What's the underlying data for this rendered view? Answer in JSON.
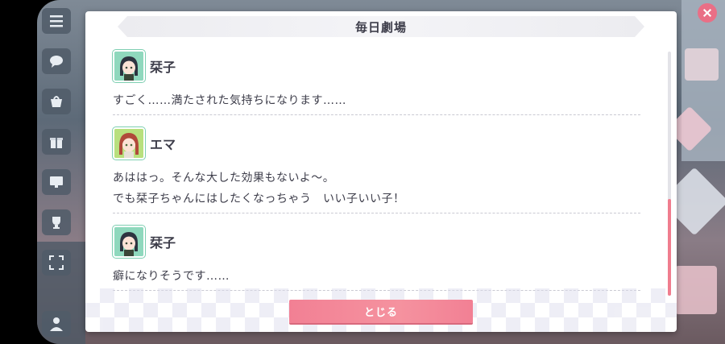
{
  "dialog": {
    "title": "毎日劇場",
    "close_label": "とじる"
  },
  "entries": [
    {
      "speaker": "栞子",
      "lines": [
        "すごく……満たされた気持ちになります……"
      ]
    },
    {
      "speaker": "エマ",
      "lines": [
        "あははっ。そんな大した効果もないよ〜。",
        "でも栞子ちゃんにはしたくなっちゃう　いい子いい子！"
      ]
    },
    {
      "speaker": "栞子",
      "lines": [
        "癖になりそうです……"
      ]
    }
  ],
  "colors": {
    "accent": "#f28094",
    "scroll_thumb": "#f07d8e",
    "text": "#3d3d4a"
  },
  "icons": [
    "menu-icon",
    "chat-icon",
    "shop-icon",
    "gift-icon",
    "screen-icon",
    "trophy-icon",
    "fullscreen-icon",
    "person-icon",
    "close-icon"
  ]
}
